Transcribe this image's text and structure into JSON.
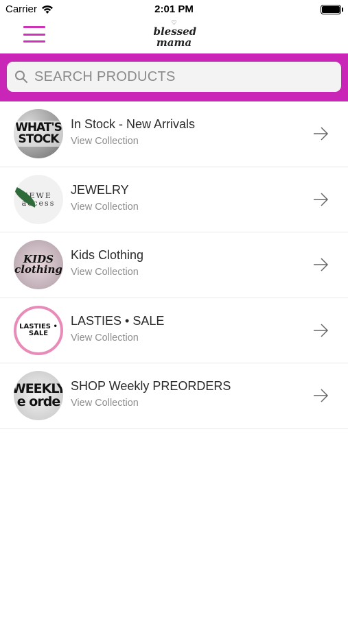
{
  "status_bar": {
    "carrier": "Carrier",
    "time": "2:01 PM"
  },
  "nav": {
    "logo_line1": "blessed",
    "logo_line2": "mama",
    "accent_color": "#cc33b8"
  },
  "search": {
    "placeholder": "SEARCH PRODUCTS",
    "band_color": "#c925b6"
  },
  "collections": [
    {
      "title": "In Stock - New Arrivals",
      "subtitle": "View Collection",
      "thumb_text": "WHAT'S STOCK"
    },
    {
      "title": "JEWELRY",
      "subtitle": "View Collection",
      "thumb_text": "JEWE access"
    },
    {
      "title": "Kids Clothing",
      "subtitle": "View Collection",
      "thumb_text": "KIDS clothing"
    },
    {
      "title": "LASTIES • SALE",
      "subtitle": "View Collection",
      "thumb_text": "LASTIES • SALE"
    },
    {
      "title": "SHOP Weekly PREORDERS",
      "subtitle": "View Collection",
      "thumb_text": "WEEKLY e orde"
    }
  ]
}
